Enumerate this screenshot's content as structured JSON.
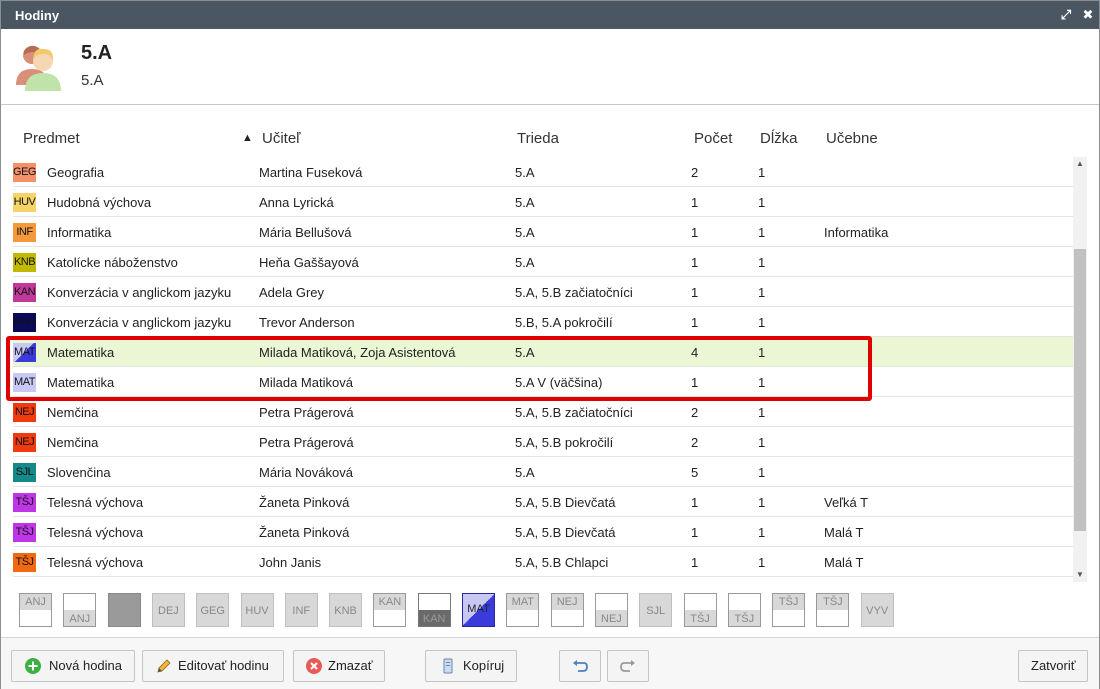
{
  "window": {
    "title": "Hodiny",
    "maximize_glyph": "⤢",
    "close_glyph": "✖"
  },
  "header": {
    "title": "5.A",
    "subtitle": "5.A"
  },
  "columns": {
    "subject": "Predmet",
    "sort_glyph": "▲",
    "teacher": "Učiteľ",
    "class": "Trieda",
    "count": "Počet",
    "length": "Dĺžka",
    "rooms": "Učebne"
  },
  "rows": [
    {
      "code": "GEG",
      "color": "#f4906a",
      "subject": "Geografia",
      "teacher": "Martina Fuseková",
      "class": "5.A",
      "count": "2",
      "length": "1",
      "rooms": ""
    },
    {
      "code": "HUV",
      "color": "#f7d46a",
      "subject": "Hudobná výchova",
      "teacher": "Anna Lyrická",
      "class": "5.A",
      "count": "1",
      "length": "1",
      "rooms": ""
    },
    {
      "code": "INF",
      "color": "#f59a3c",
      "subject": "Informatika",
      "teacher": "Mária Bellušová",
      "class": "5.A",
      "count": "1",
      "length": "1",
      "rooms": "Informatika"
    },
    {
      "code": "KNB",
      "color": "#c2b800",
      "subject": "Katolícke náboženstvo",
      "teacher": "Heňa Gaššayová",
      "class": "5.A",
      "count": "1",
      "length": "1",
      "rooms": ""
    },
    {
      "code": "KAN",
      "color": "#c0399a",
      "subject": "Konverzácia v anglickom jazyku",
      "teacher": "Adela Grey",
      "class": "5.A, 5.B začiatočníci",
      "count": "1",
      "length": "1",
      "rooms": ""
    },
    {
      "code": "KAN",
      "color": "#0a0a5a",
      "subject": "Konverzácia v anglickom jazyku",
      "teacher": "Trevor Anderson",
      "class": "5.B, 5.A pokročilí",
      "count": "1",
      "length": "1",
      "rooms": ""
    },
    {
      "code": "MAT",
      "color": "#3b3bdc",
      "split": true,
      "subject": "Matematika",
      "teacher": "Milada Matiková, Zoja Asistentová",
      "class": "5.A",
      "count": "4",
      "length": "1",
      "rooms": "",
      "selected": true
    },
    {
      "code": "MAT",
      "color": "#c8c8f4",
      "subject": "Matematika",
      "teacher": "Milada Matiková",
      "class": "5.A V (väčšina)",
      "count": "1",
      "length": "1",
      "rooms": ""
    },
    {
      "code": "NEJ",
      "color": "#f03a10",
      "subject": "Nemčina",
      "teacher": "Petra Prágerová",
      "class": "5.A, 5.B začiatočníci",
      "count": "2",
      "length": "1",
      "rooms": ""
    },
    {
      "code": "NEJ",
      "color": "#f03a10",
      "subject": "Nemčina",
      "teacher": "Petra Prágerová",
      "class": "5.A, 5.B pokročilí",
      "count": "2",
      "length": "1",
      "rooms": ""
    },
    {
      "code": "SJL",
      "color": "#158a8a",
      "subject": "Slovenčina",
      "teacher": "Mária Nováková",
      "class": "5.A",
      "count": "5",
      "length": "1",
      "rooms": ""
    },
    {
      "code": "TŠJ",
      "color": "#bf36e8",
      "subject": "Telesná výchova",
      "teacher": "Žaneta Pinková",
      "class": "5.A, 5.B Dievčatá",
      "count": "1",
      "length": "1",
      "rooms": "Veľká T"
    },
    {
      "code": "TŠJ",
      "color": "#bf36e8",
      "subject": "Telesná výchova",
      "teacher": "Žaneta Pinková",
      "class": "5.A, 5.B Dievčatá",
      "count": "1",
      "length": "1",
      "rooms": "Malá T"
    },
    {
      "code": "TŠJ",
      "color": "#f26a10",
      "subject": "Telesná výchova",
      "teacher": "John Janis",
      "class": "5.A, 5.B Chlapci",
      "count": "1",
      "length": "1",
      "rooms": "Malá T"
    }
  ],
  "palette": [
    {
      "code": "ANJ",
      "kind": "top"
    },
    {
      "code": "ANJ",
      "kind": "bottom"
    },
    {
      "code": "",
      "kind": "dark"
    },
    {
      "code": "DEJ",
      "kind": "gray"
    },
    {
      "code": "GEG",
      "kind": "gray"
    },
    {
      "code": "HUV",
      "kind": "gray"
    },
    {
      "code": "INF",
      "kind": "gray"
    },
    {
      "code": "KNB",
      "kind": "gray"
    },
    {
      "code": "KAN",
      "kind": "top"
    },
    {
      "code": "KAN",
      "kind": "bottomdark"
    },
    {
      "code": "MAT",
      "kind": "mat"
    },
    {
      "code": "MAT",
      "kind": "top"
    },
    {
      "code": "NEJ",
      "kind": "top"
    },
    {
      "code": "NEJ",
      "kind": "bottom"
    },
    {
      "code": "SJL",
      "kind": "gray"
    },
    {
      "code": "TŠJ",
      "kind": "bottom"
    },
    {
      "code": "TŠJ",
      "kind": "bottom"
    },
    {
      "code": "TŠJ",
      "kind": "top"
    },
    {
      "code": "TŠJ",
      "kind": "top"
    },
    {
      "code": "VYV",
      "kind": "gray"
    }
  ],
  "footer": {
    "new_label": "Nová hodina",
    "edit_label": "Editovať hodinu",
    "delete_label": "Zmazať",
    "copy_label": "Kopíruj",
    "close_label": "Zatvoriť"
  }
}
